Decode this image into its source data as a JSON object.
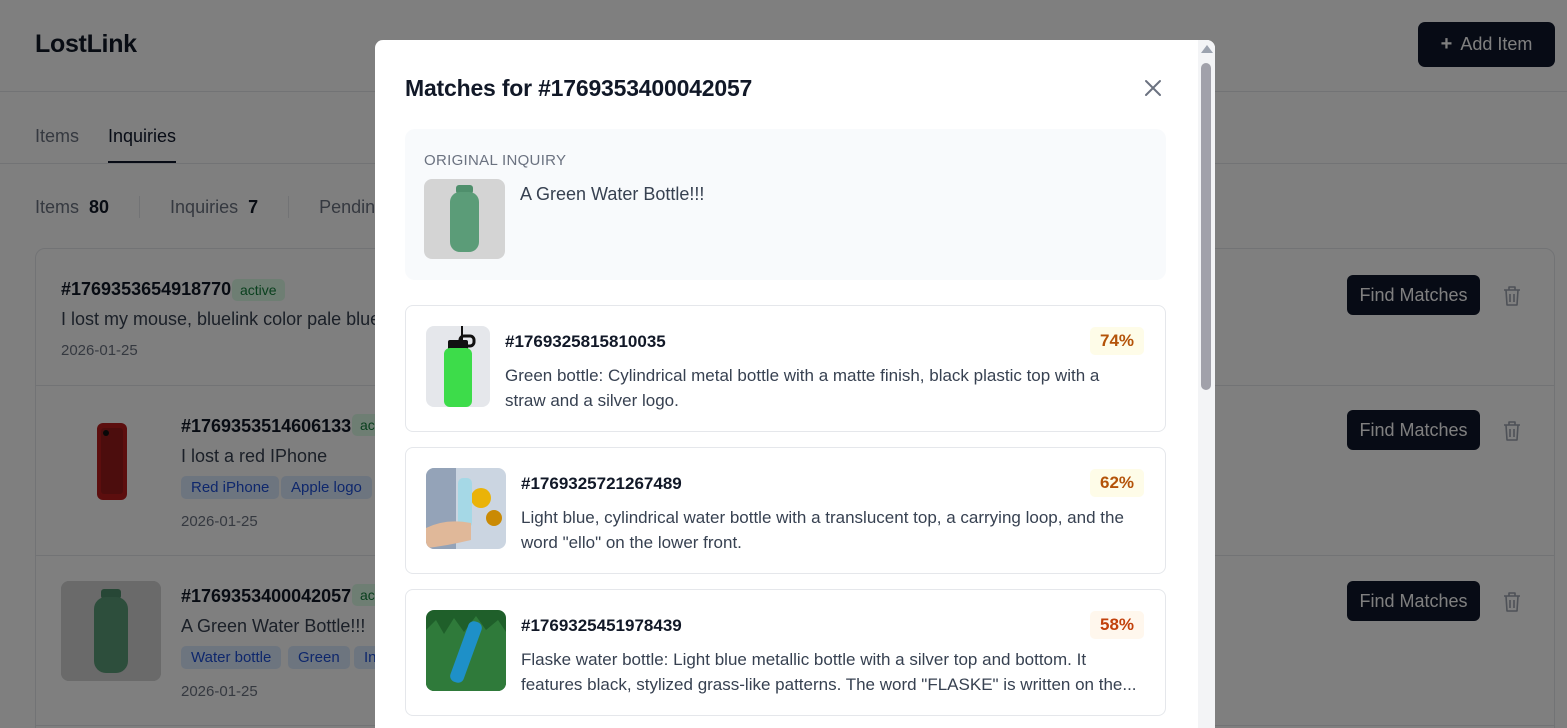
{
  "app": {
    "brand": "LostLink",
    "add_button_label": "Add Item"
  },
  "tabs": [
    {
      "label": "Items",
      "active": false
    },
    {
      "label": "Inquiries",
      "active": true
    }
  ],
  "stats": [
    {
      "label": "Items",
      "value": "80"
    },
    {
      "label": "Inquiries",
      "value": "7"
    },
    {
      "label": "Pending",
      "value": ""
    }
  ],
  "inquiries": [
    {
      "id": "#1769353654918770",
      "status": "active",
      "description": "I lost my mouse, bluelink color pale blue",
      "date": "2026-01-25",
      "tags": [],
      "image": "none",
      "action_label": "Find Matches"
    },
    {
      "id": "#1769353514606133",
      "status": "ac",
      "description": "I lost a red IPhone",
      "date": "2026-01-25",
      "tags": [
        "Red iPhone",
        "Apple logo"
      ],
      "image": "red-phone",
      "action_label": "Find Matches"
    },
    {
      "id": "#1769353400042057",
      "status": "ac",
      "description": "A Green Water Bottle!!!",
      "date": "2026-01-25",
      "tags": [
        "Water bottle",
        "Green",
        "In"
      ],
      "image": "green-bottle",
      "action_label": "Find Matches"
    }
  ],
  "modal": {
    "title": "Matches for #1769353400042057",
    "original_label": "ORIGINAL INQUIRY",
    "original_text": "A Green Water Bottle!!!",
    "matches": [
      {
        "id": "#1769325815810035",
        "score": "74%",
        "score_color": "#b45309",
        "score_bg": "#fefce8",
        "description": "Green bottle: Cylindrical metal bottle with a matte finish, black plastic top with a straw and a silver logo."
      },
      {
        "id": "#1769325721267489",
        "score": "62%",
        "score_color": "#b45309",
        "score_bg": "#fefce8",
        "description": "Light blue, cylindrical water bottle with a translucent top, a carrying loop, and the word \"ello\" on the lower front."
      },
      {
        "id": "#1769325451978439",
        "score": "58%",
        "score_color": "#c2410c",
        "score_bg": "#fff7ed",
        "description": "Flaske water bottle: Light blue metallic bottle with a silver top and bottom. It features black, stylized grass-like patterns. The word \"FLASKE\" is written on the..."
      }
    ]
  },
  "icons": {
    "close": "close-icon",
    "trash": "trash-icon",
    "plus": "plus-icon"
  }
}
